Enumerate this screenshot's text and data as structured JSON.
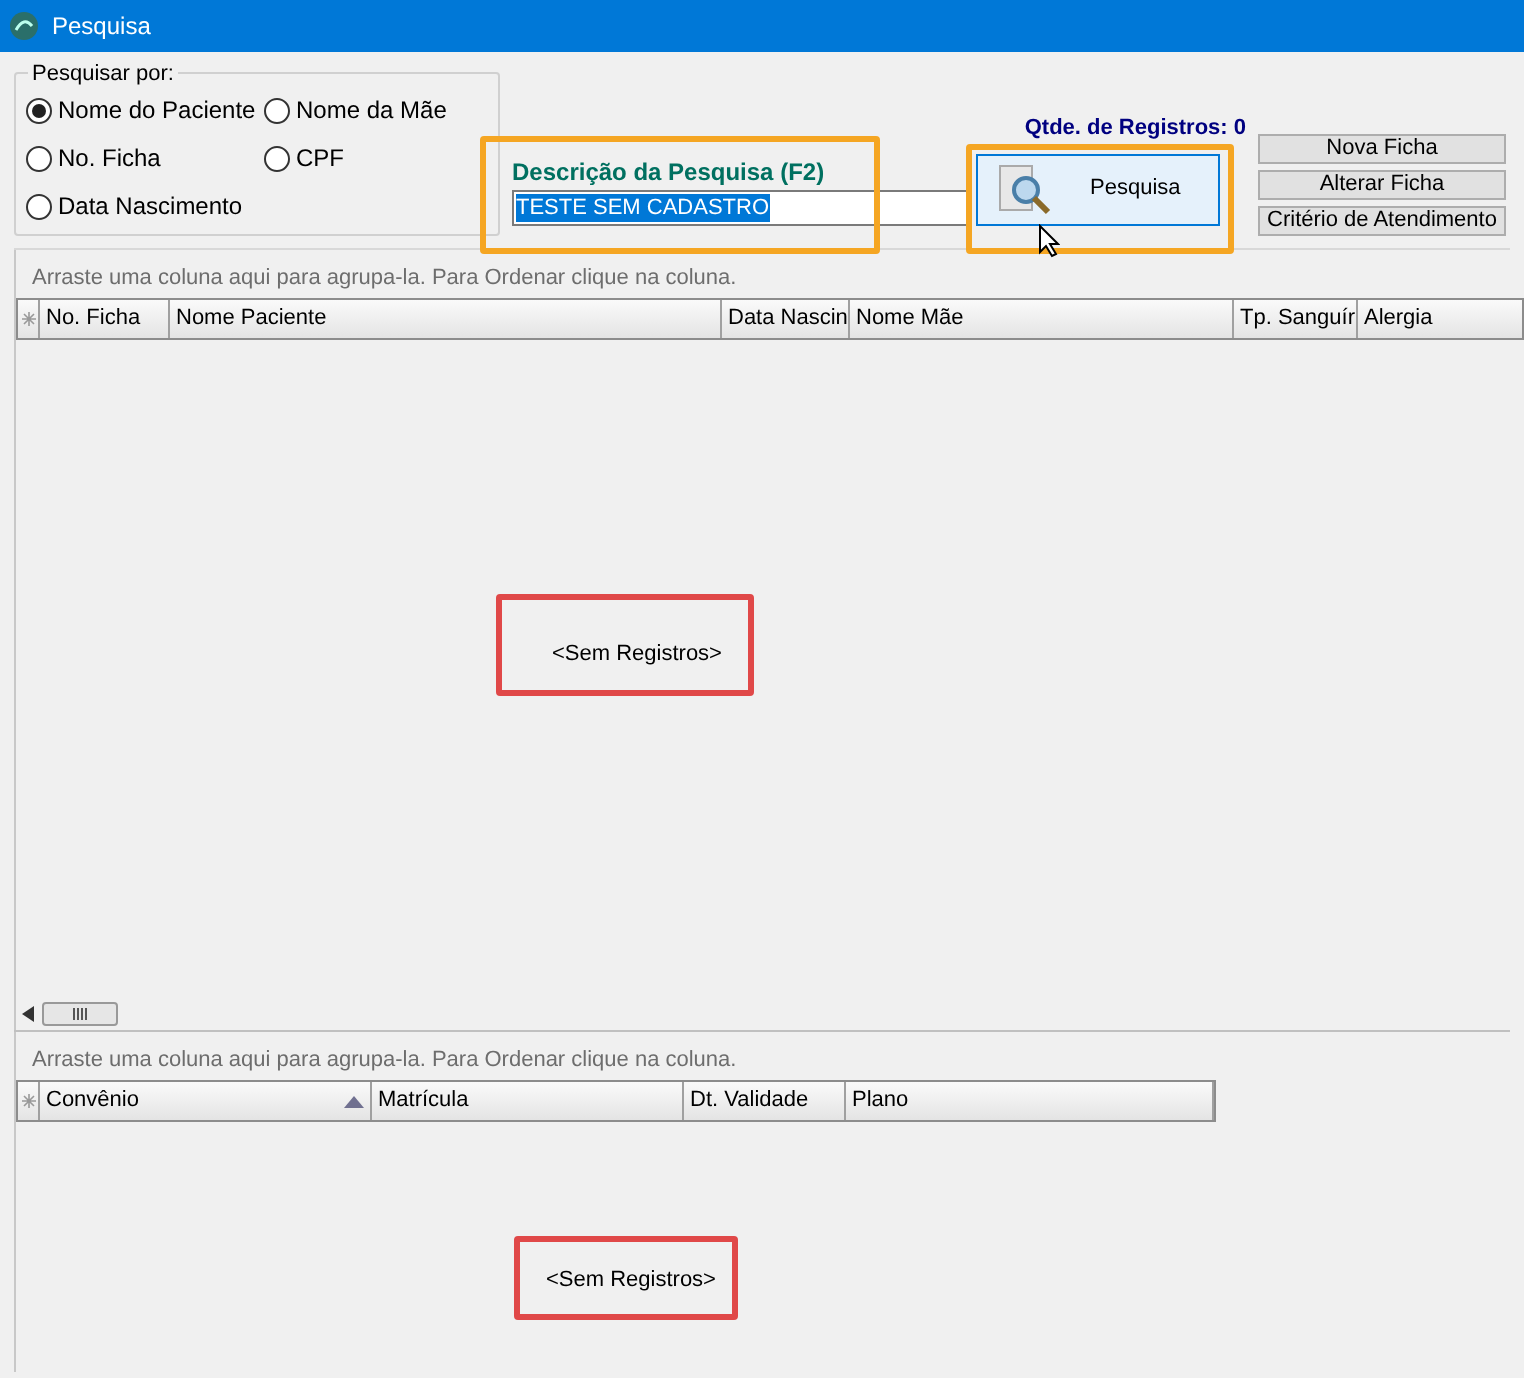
{
  "window": {
    "title": "Pesquisa"
  },
  "search_by": {
    "label": "Pesquisar por:",
    "options": [
      {
        "label": "Nome do Paciente",
        "selected": true
      },
      {
        "label": "Nome da Mãe",
        "selected": false
      },
      {
        "label": "No. Ficha",
        "selected": false
      },
      {
        "label": "CPF",
        "selected": false
      },
      {
        "label": "Data Nascimento",
        "selected": false
      }
    ]
  },
  "search": {
    "label": "Descrição da Pesquisa (F2)",
    "value": "TESTE SEM CADASTRO"
  },
  "record_count": "Qtde. de Registros: 0",
  "search_button": "Pesquisa",
  "buttons": [
    "Nova Ficha",
    "Alterar Ficha",
    "Critério de Atendimento"
  ],
  "patients_grid": {
    "group_hint": "Arraste uma coluna aqui para agrupa-la. Para Ordenar clique na coluna.",
    "columns": [
      "No. Ficha",
      "Nome Paciente",
      "Data Nascin",
      "Nome Mãe",
      "Tp. Sanguír",
      "Alergia"
    ],
    "empty_text": "<Sem Registros>"
  },
  "plans_grid": {
    "group_hint": "Arraste uma coluna aqui para agrupa-la. Para Ordenar clique na coluna.",
    "columns": [
      {
        "label": "Convênio",
        "sorted": true
      },
      {
        "label": "Matrícula",
        "sorted": false
      },
      {
        "label": "Dt. Validade",
        "sorted": false
      },
      {
        "label": "Plano",
        "sorted": false
      }
    ],
    "empty_text": "<Sem Registros>"
  }
}
